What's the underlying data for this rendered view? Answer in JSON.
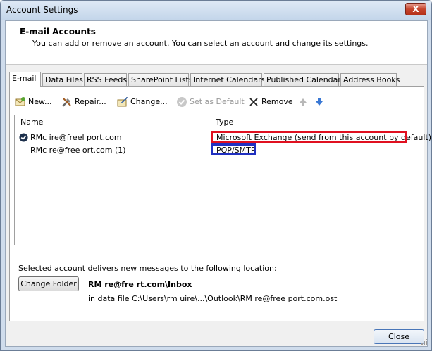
{
  "window": {
    "title": "Account Settings",
    "close_glyph": "X"
  },
  "header": {
    "title": "E-mail Accounts",
    "description": "You can add or remove an account. You can select an account and change its settings."
  },
  "tabs": [
    "E-mail",
    "Data Files",
    "RSS Feeds",
    "SharePoint Lists",
    "Internet Calendars",
    "Published Calendars",
    "Address Books"
  ],
  "toolbar": {
    "new": "New...",
    "repair": "Repair...",
    "change": "Change...",
    "set_default": "Set as Default",
    "remove": "Remove"
  },
  "list": {
    "columns": {
      "name": "Name",
      "type": "Type"
    },
    "rows": [
      {
        "name": "RMc      ire@freel               port.com",
        "type": "Microsoft Exchange (send from this account by default)",
        "default": true
      },
      {
        "name": "RMc      re@free                 ort.com (1)",
        "type": "POP/SMTP",
        "default": false
      }
    ]
  },
  "location": {
    "label": "Selected account delivers new messages to the following location:",
    "button": "Change Folder",
    "path_primary": "RM        re@fre                    rt.com\\Inbox",
    "path_secondary": "in data file C:\\Users\\rm     uire\\...\\Outlook\\RM     re@free                  port.com.ost"
  },
  "footer": {
    "close": "Close"
  },
  "colors": {
    "highlight_red": "#e01020",
    "highlight_blue": "#2030c0"
  }
}
